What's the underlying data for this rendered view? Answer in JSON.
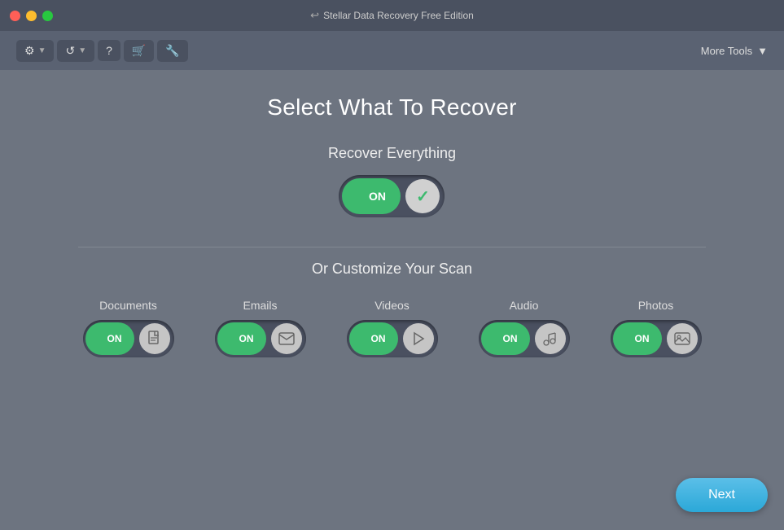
{
  "titlebar": {
    "title": "Stellar Data Recovery Free Edition",
    "back_icon": "↩"
  },
  "toolbar": {
    "settings_label": "⚙",
    "refresh_label": "↺",
    "help_label": "?",
    "cart_label": "🛒",
    "wrench_label": "🔧",
    "more_tools_label": "More Tools",
    "chevron": "▼"
  },
  "main": {
    "page_title": "Select What To Recover",
    "recover_everything_label": "Recover Everything",
    "toggle_on": "ON",
    "customize_label": "Or Customize Your Scan",
    "categories": [
      {
        "id": "documents",
        "label": "Documents",
        "on": "ON",
        "icon": "doc"
      },
      {
        "id": "emails",
        "label": "Emails",
        "on": "ON",
        "icon": "email"
      },
      {
        "id": "videos",
        "label": "Videos",
        "on": "ON",
        "icon": "video"
      },
      {
        "id": "audio",
        "label": "Audio",
        "on": "ON",
        "icon": "audio"
      },
      {
        "id": "photos",
        "label": "Photos",
        "on": "ON",
        "icon": "photo"
      }
    ]
  },
  "next_button": {
    "label": "Next"
  }
}
